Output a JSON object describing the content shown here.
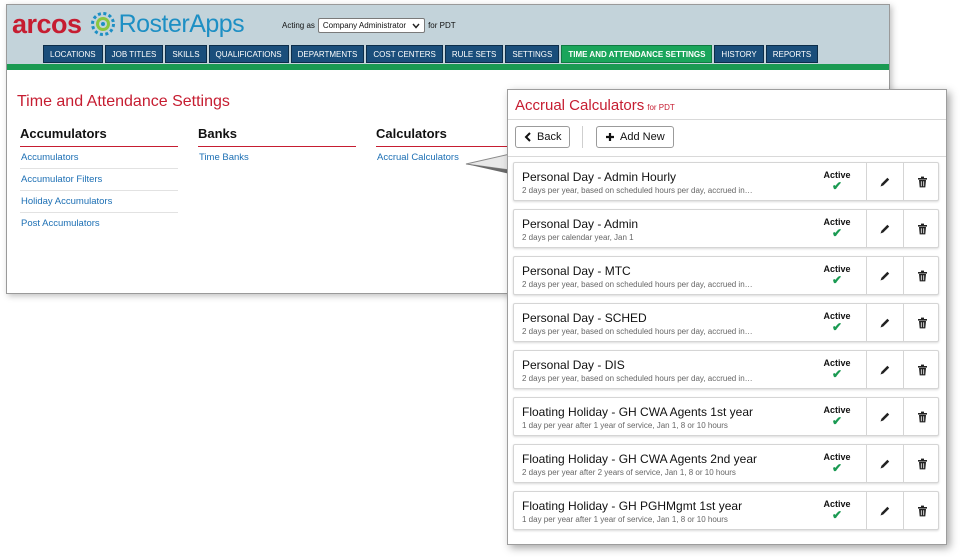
{
  "brand": {
    "name": "arcos",
    "app": "RosterApps"
  },
  "acting": {
    "prefix": "Acting as",
    "role": "Company Administrator",
    "suffix": "for PDT"
  },
  "nav": [
    "LOCATIONS",
    "JOB TITLES",
    "SKILLS",
    "QUALIFICATIONS",
    "DEPARTMENTS",
    "COST CENTERS",
    "RULE SETS",
    "SETTINGS",
    "TIME AND ATTENDANCE SETTINGS",
    "HISTORY",
    "REPORTS"
  ],
  "nav_active": "TIME AND ATTENDANCE SETTINGS",
  "page_title": "Time and Attendance Settings",
  "columns": [
    {
      "heading": "Accumulators",
      "links": [
        "Accumulators",
        "Accumulator Filters",
        "Holiday Accumulators",
        "Post Accumulators"
      ]
    },
    {
      "heading": "Banks",
      "links": [
        "Time Banks"
      ]
    },
    {
      "heading": "Calculators",
      "links": [
        "Accrual Calculators"
      ]
    }
  ],
  "panel": {
    "title": "Accrual Calculators",
    "subtitle": "for PDT",
    "back_label": "Back",
    "add_label": "Add New",
    "status_label": "Active",
    "items": [
      {
        "name": "Personal Day - Admin Hourly",
        "desc": "2 days per year, based on scheduled hours per day, accrued in…",
        "status": "Active"
      },
      {
        "name": "Personal Day - Admin",
        "desc": "2 days per calendar year, Jan 1",
        "status": "Active"
      },
      {
        "name": "Personal Day - MTC",
        "desc": "2 days per year, based on scheduled hours per day, accrued in…",
        "status": "Active"
      },
      {
        "name": "Personal Day - SCHED",
        "desc": "2 days per year, based on scheduled hours per day, accrued in…",
        "status": "Active"
      },
      {
        "name": "Personal Day - DIS",
        "desc": "2 days per year, based on scheduled hours per day, accrued in…",
        "status": "Active"
      },
      {
        "name": "Floating Holiday - GH CWA Agents 1st year",
        "desc": "1 day per year after 1 year of service, Jan 1, 8 or 10 hours",
        "status": "Active"
      },
      {
        "name": "Floating Holiday - GH CWA Agents 2nd year",
        "desc": "2 days per year after 2 years of service, Jan 1, 8 or 10 hours",
        "status": "Active"
      },
      {
        "name": "Floating Holiday - GH PGHMgmt 1st year",
        "desc": "1 day per year after 1 year of service, Jan 1, 8 or 10 hours",
        "status": "Active"
      }
    ]
  },
  "icons": {
    "brand_gear": "gear-logo-icon",
    "back": "chevron-left-icon",
    "add": "plus-icon",
    "check": "checkmark-icon",
    "edit": "pencil-icon",
    "delete": "trash-icon",
    "dropdown": "chevron-down-icon"
  },
  "colors": {
    "brand_red": "#c61d31",
    "nav_blue": "#1a4e7b",
    "active_green": "#1aa55b",
    "link_blue": "#1c6fb4",
    "topbar": "#c3d3da"
  }
}
